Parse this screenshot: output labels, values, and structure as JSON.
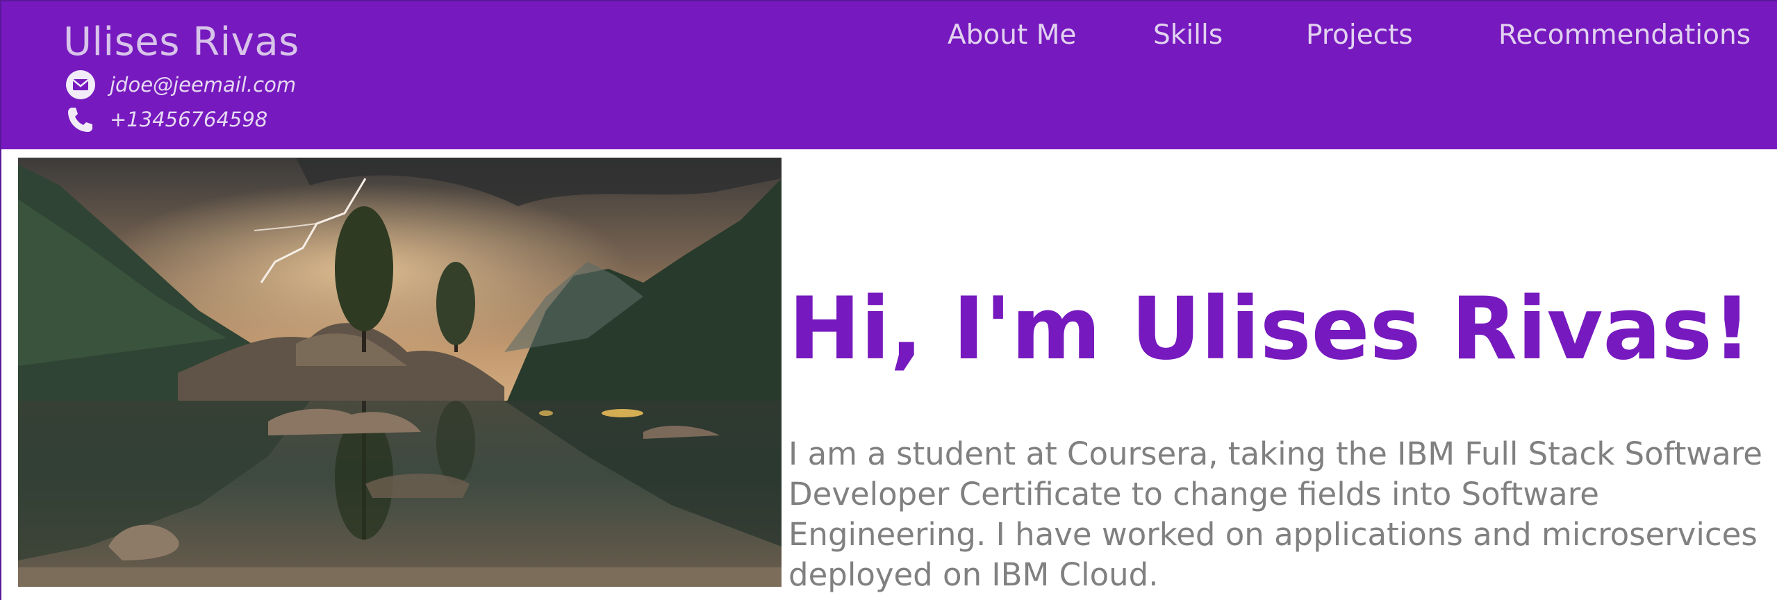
{
  "header": {
    "brand_name": "Ulises Rivas",
    "email": "jdoe@jeemail.com",
    "phone": "+13456764598",
    "email_icon": "envelope-icon",
    "phone_icon": "phone-icon",
    "nav": [
      {
        "label": "About Me"
      },
      {
        "label": "Skills"
      },
      {
        "label": "Projects"
      },
      {
        "label": "Recommendations"
      }
    ],
    "background_color": "#7619be"
  },
  "hero": {
    "image_subject": "mountain lake landscape at dusk with lightning",
    "title": "Hi, I'm Ulises Rivas!",
    "title_icon": "waving-hand-icon",
    "bio": "I am a student at Coursera, taking the IBM Full Stack Software Developer Certificate to change fields into Software Engineering. I have worked on applications and microservices deployed on IBM Cloud.",
    "title_color": "#7619be",
    "bio_color": "#808080"
  }
}
